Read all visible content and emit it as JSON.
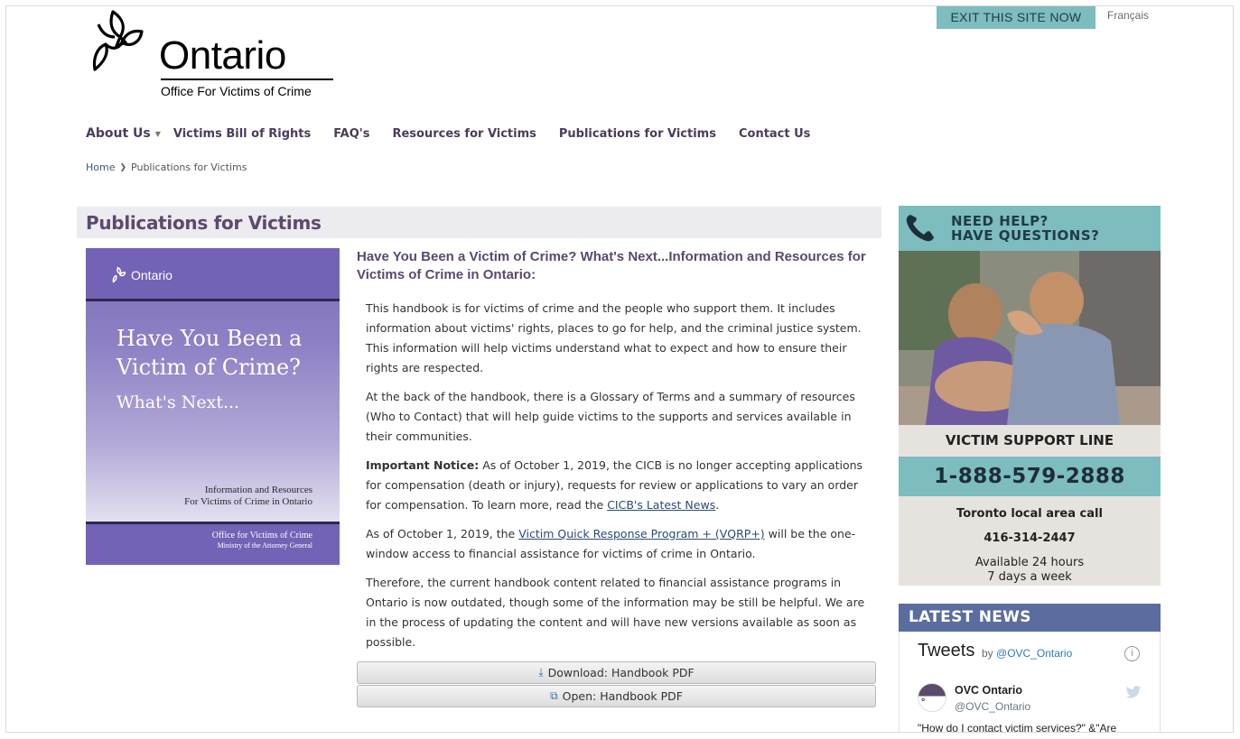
{
  "header": {
    "logo_wordmark": "Ontario",
    "logo_subtitle": "Office For Victims of Crime",
    "exit_label": "EXIT THIS SITE NOW",
    "language_link": "Français"
  },
  "nav": {
    "items": [
      {
        "label": "About Us"
      },
      {
        "label": "Victims Bill of Rights"
      },
      {
        "label": "FAQ's"
      },
      {
        "label": "Resources for Victims"
      },
      {
        "label": "Publications for Victims"
      },
      {
        "label": "Contact Us"
      }
    ]
  },
  "breadcrumb": {
    "home": "Home",
    "current": "Publications for Victims"
  },
  "main": {
    "page_title": "Publications for Victims",
    "cover": {
      "logo": "Ontario",
      "title": "Have You Been a Victim of Crime?",
      "subtitle": "What's Next...",
      "info_line1": "Information and Resources",
      "info_line2": "For Victims of Crime in Ontario",
      "office_line1": "Office for Victims of Crime",
      "office_line2": "Ministry of the Attorney General"
    },
    "article_title": "Have You Been a Victim of Crime? What's Next...Information and Resources for Victims of Crime in Ontario:",
    "p1": "This handbook is for victims of crime and the people who support them. It includes information about victims' rights, places to go for help, and the criminal justice system. This information will help victims understand what to expect and how to ensure their rights are respected.",
    "p2": "At the back of the handbook, there is a Glossary of Terms and a summary of resources (Who to Contact) that will help guide victims to the supports and services available in their communities.",
    "p3_label": "Important Notice:",
    "p3_text": " As of October 1, 2019, the CICB is no longer accepting applications for compensation (death or injury), requests for review or applications to vary an order for compensation. To learn more, read the ",
    "p3_link": "CICB's Latest News",
    "p3_end": ".",
    "p4_text": "As of October 1, 2019, the ",
    "p4_link": "Victim Quick Response Program + (VQRP+)",
    "p4_end": " will be the one-window access to financial assistance for victims of crime in Ontario.",
    "p5": "Therefore, the current handbook content related to financial assistance programs in Ontario is now outdated, though some of the information may be still be helpful. We are in the process of updating the content and will have new versions available as soon as possible.",
    "download_label": "Download: Handbook PDF",
    "open_label": "Open: Handbook PDF"
  },
  "sidebar": {
    "help_line1": "NEED HELP?",
    "help_line2": "HAVE QUESTIONS?",
    "support_label": "VICTIM SUPPORT LINE",
    "support_number": "1-888-579-2888",
    "local_label": "Toronto local area call",
    "local_number": "416-314-2447",
    "availability_line1": "Available 24 hours",
    "availability_line2": "7 days a week",
    "news_title": "LATEST NEWS",
    "tweets_title": "Tweets",
    "tweets_by": "by",
    "tweets_handle": "@OVC_Ontario",
    "tweet_name": "OVC Ontario",
    "tweet_handle": "@OVC_Ontario",
    "tweet_text": "\"How do I contact victim services?\" &\"Are"
  },
  "colors": {
    "accent_teal": "#7dbcbf",
    "brand_purple": "#5b4a6e",
    "news_blue": "#5a6d9e",
    "cover_purple": "#7462b6"
  }
}
